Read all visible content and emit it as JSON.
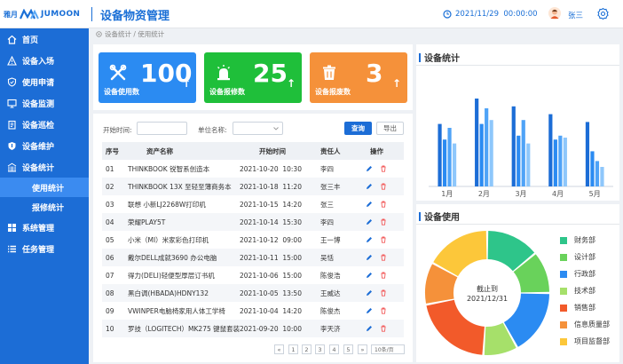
{
  "header": {
    "logo_cn": "雅月",
    "logo_en": "JUMOON",
    "title": "设备物资管理",
    "datetime": "2021/11/29  00:00:00",
    "user": "张三"
  },
  "sidebar": {
    "items": [
      {
        "label": "首页",
        "icon": "home-icon"
      },
      {
        "label": "设备入场",
        "icon": "warning-triangle-icon"
      },
      {
        "label": "使用申请",
        "icon": "shield-check-icon"
      },
      {
        "label": "设备监测",
        "icon": "monitor-icon"
      },
      {
        "label": "设备巡检",
        "icon": "clipboard-icon"
      },
      {
        "label": "设备维护",
        "icon": "shield-icon"
      },
      {
        "label": "设备统计",
        "icon": "building-icon"
      }
    ],
    "sub_items": [
      {
        "label": "使用统计",
        "active": true
      },
      {
        "label": "报修统计",
        "active": false
      }
    ],
    "bottom_items": [
      {
        "label": "系统管理",
        "icon": "grid-icon"
      },
      {
        "label": "任务管理",
        "icon": "list-icon"
      }
    ]
  },
  "breadcrumb": "设备统计 / 使用统计",
  "cards": [
    {
      "value": "100",
      "label": "设备使用数",
      "color": "#2b8bf2",
      "icon": "tools-icon"
    },
    {
      "value": "25",
      "label": "设备报修数",
      "color": "#1fbf3a",
      "icon": "alarm-icon"
    },
    {
      "value": "3",
      "label": "设备报废数",
      "color": "#f5913a",
      "icon": "trash-icon"
    }
  ],
  "filters": {
    "start_label": "开始时间:",
    "unit_label": "单位名称:",
    "query": "查询",
    "export": "导出"
  },
  "table": {
    "headers": [
      "序号",
      "资产名称",
      "开始时间",
      "责任人",
      "操作"
    ],
    "rows": [
      [
        "01",
        "THINKBOOK 锐智系创造本",
        "2021-10-20  10:30",
        "李四"
      ],
      [
        "02",
        "THINKBOOK 13X 至轻至薄商务本",
        "2021-10-18  11:20",
        "张三丰"
      ],
      [
        "03",
        "联想 小新LJ2268W打印机",
        "2021-10-15  14:20",
        "张三"
      ],
      [
        "04",
        "荣耀PLAY5T",
        "2021-10-14  15:30",
        "李四"
      ],
      [
        "05",
        "小米（MI）米家彩色打印机",
        "2021-10-12  09:00",
        "王一博"
      ],
      [
        "06",
        "戴尔DELL成就3690 办公电脑",
        "2021-10-11  15:00",
        "吴恬"
      ],
      [
        "07",
        "得力(DELI)轻便型厚层订书机",
        "2021-10-06  15:00",
        "陈俊浩"
      ],
      [
        "08",
        "黑白调(HBADA)HDNY132",
        "2021-10-05  13:50",
        "王威达"
      ],
      [
        "09",
        "VWINPER电脑椅家用人体工学椅",
        "2021-10-04  14:20",
        "陈俊杰"
      ],
      [
        "10",
        "罗技（LOGITECH）MK275 键鼠套装",
        "2021-09-20  10:00",
        "李天济"
      ]
    ]
  },
  "pagination": {
    "prev": "«",
    "pages": [
      "1",
      "2",
      "3",
      "4",
      "5"
    ],
    "next": "»",
    "page_size": "10条/页"
  },
  "stats_panel": {
    "title": "设备统计"
  },
  "usage_panel": {
    "title": "设备使用"
  },
  "chart_data": [
    {
      "type": "bar",
      "categories": [
        "1月",
        "2月",
        "3月",
        "4月",
        "5月"
      ],
      "series": [
        {
          "values": [
            32,
            45,
            41,
            37,
            33
          ],
          "color": "#1c6dd6"
        },
        {
          "values": [
            24,
            32,
            26,
            24,
            18
          ],
          "color": "#2b8bf2"
        },
        {
          "values": [
            30,
            40,
            34,
            26,
            13
          ],
          "color": "#4fa3f7"
        },
        {
          "values": [
            22,
            34,
            22,
            25,
            10
          ],
          "color": "#8ec7fb"
        }
      ],
      "ylim": [
        0,
        50
      ]
    },
    {
      "type": "pie",
      "center_label": [
        "截止到",
        "2021/12/31"
      ],
      "labels": [
        "财务部",
        "设计部",
        "行政部",
        "技术部",
        "销售部",
        "信息质量部",
        "项目监督部"
      ],
      "values": [
        14,
        11,
        17,
        9,
        21,
        11,
        17
      ],
      "colors": [
        "#2ec58a",
        "#69d25b",
        "#2b8bf2",
        "#a6e06a",
        "#f25a2a",
        "#f5913a",
        "#fcc73a"
      ]
    }
  ]
}
